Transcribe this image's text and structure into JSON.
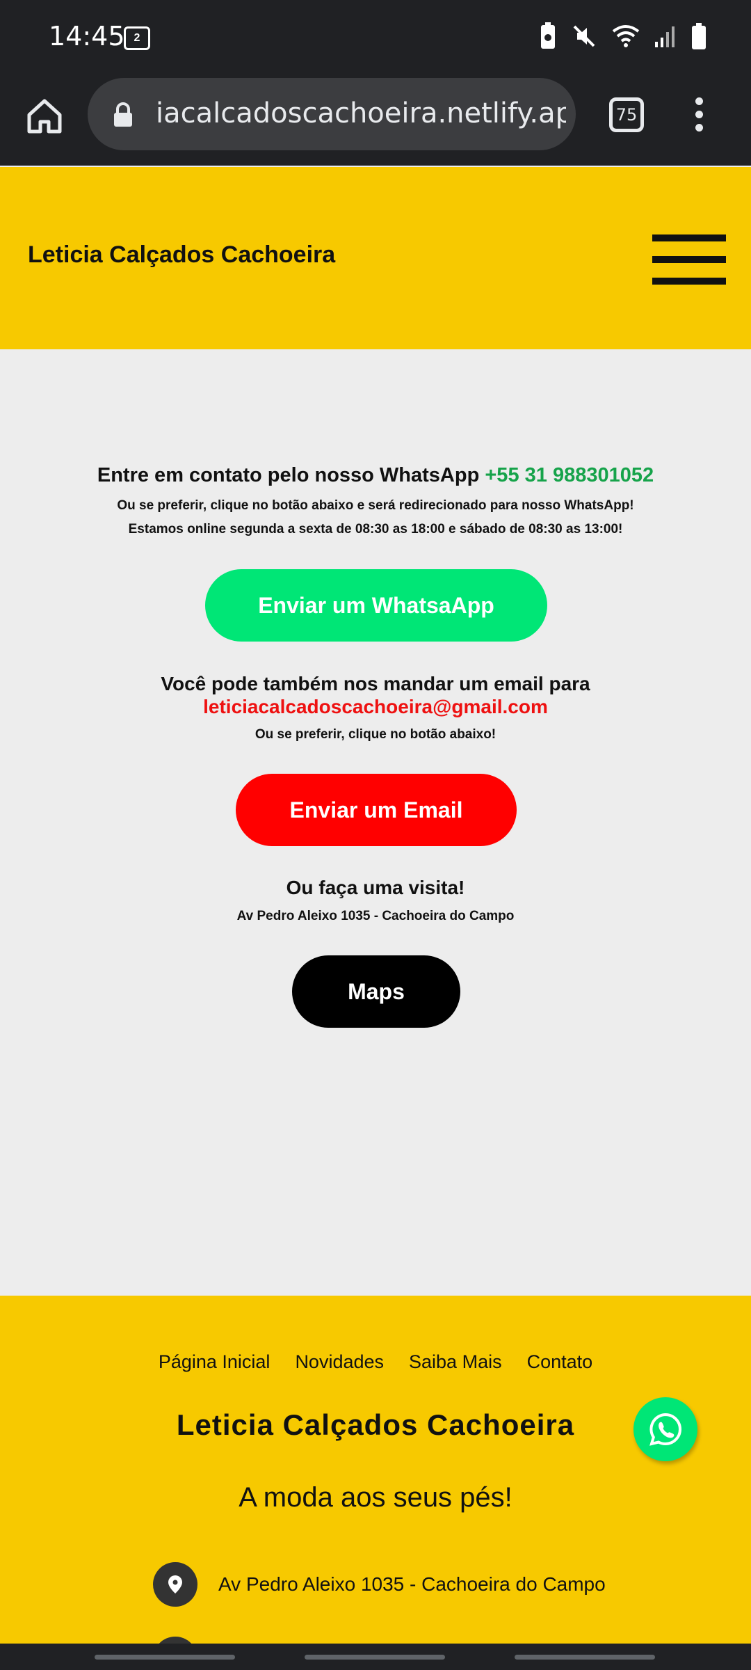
{
  "status_bar": {
    "time": "14:45",
    "voicemail_count": "2",
    "icons": [
      "voicemail-icon",
      "battery-saver-icon",
      "mute-icon",
      "wifi-icon",
      "signal-icon",
      "battery-icon"
    ]
  },
  "browser": {
    "url": "iacalcadoscachoeira.netlify.app",
    "tab_count": "75"
  },
  "header": {
    "brand": "Leticia Calçados Cachoeira"
  },
  "contact": {
    "whatsapp_prefix": "Entre em contato pelo nosso WhatsApp ",
    "whatsapp_phone": "+55 31 988301052",
    "whatsapp_note": "Ou se preferir, clique no botão abaixo e será redirecionado para nosso WhatsApp!",
    "hours": "Estamos online segunda a sexta de 08:30 as 18:00 e sábado de 08:30 as 13:00!",
    "whatsapp_button": "Enviar um WhatsaApp",
    "email_prefix": "Você pode também nos mandar um email para",
    "email": "leticiacalcadoscachoeira@gmail.com",
    "email_note": "Ou se preferir, clique no botão abaixo!",
    "email_button": "Enviar um Email",
    "visit_title": "Ou faça uma visita!",
    "visit_address": "Av Pedro Aleixo 1035 - Cachoeira do Campo",
    "maps_button": "Maps"
  },
  "footer": {
    "nav": [
      "Página Inicial",
      "Novidades",
      "Saiba Mais",
      "Contato"
    ],
    "brand": "Leticia Calçados Cachoeira",
    "slogan": "A moda aos seus pés!",
    "address": "Av Pedro Aleixo 1035 - Cachoeira do Campo"
  },
  "colors": {
    "brand_yellow": "#f7c900",
    "whatsapp_green": "#00e676",
    "email_red": "#ff0000",
    "phone_green": "#16a34a"
  }
}
